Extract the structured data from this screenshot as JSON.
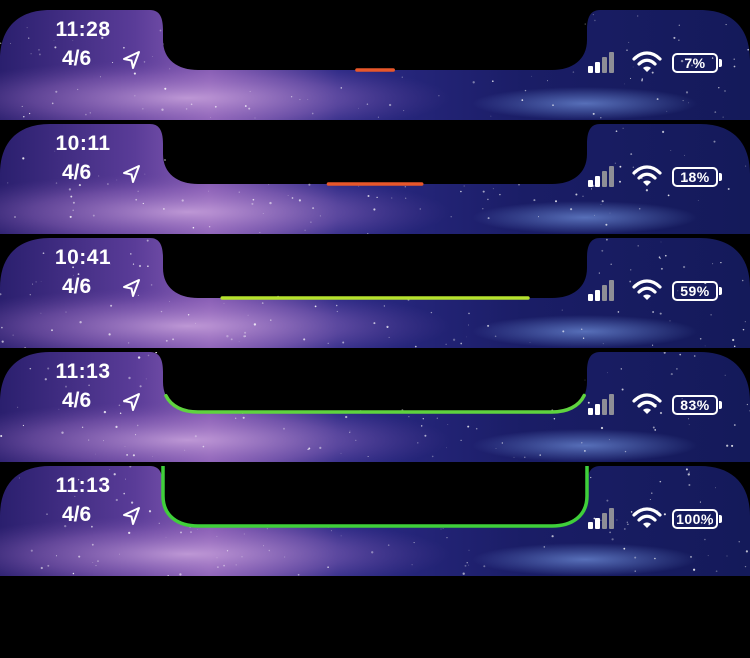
{
  "defs_note": "",
  "strips": [
    {
      "time": "11:28",
      "date": "4/6",
      "battery_label": "7%",
      "progress": 0.07,
      "progress_color": "#e8572a"
    },
    {
      "time": "10:11",
      "date": "4/6",
      "battery_label": "18%",
      "progress": 0.18,
      "progress_color": "#e8572a"
    },
    {
      "time": "10:41",
      "date": "4/6",
      "battery_label": "59%",
      "progress": 0.59,
      "progress_color": "#b5e12d"
    },
    {
      "time": "11:13",
      "date": "4/6",
      "battery_label": "83%",
      "progress": 0.83,
      "progress_color": "#5fd33f"
    },
    {
      "time": "11:13",
      "date": "4/6",
      "battery_label": "100%",
      "progress": 1.0,
      "progress_color": "#3fcf3a"
    }
  ],
  "icons": {
    "location": "location-arrow-icon",
    "signal": "cellular-signal-icon",
    "wifi": "wifi-icon",
    "battery": "battery-icon"
  }
}
